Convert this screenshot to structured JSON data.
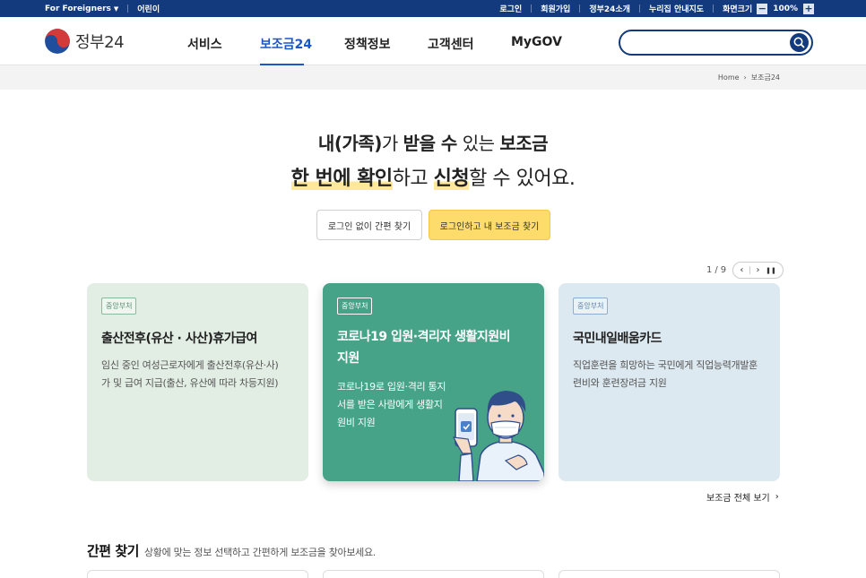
{
  "topbar": {
    "foreigners": "For Foreigners",
    "kids": "어린이",
    "links": [
      "로그인",
      "회원가입",
      "정부24소개",
      "누리집 안내지도"
    ],
    "zoom_label": "화면크기",
    "zoom_minus": "−",
    "zoom_value": "100%",
    "zoom_plus": "+"
  },
  "header": {
    "logo_text": "정부24",
    "nav": [
      "서비스",
      "보조금24",
      "정책정보",
      "고객센터",
      "MyGOV"
    ],
    "active_nav": "보조금24",
    "search_placeholder": ""
  },
  "breadcrumb": [
    "Home",
    "보조금24"
  ],
  "hero": {
    "line1": [
      {
        "text": "내(가족)",
        "style": "bold"
      },
      {
        "text": "가 ",
        "style": "normal"
      },
      {
        "text": "받을 수",
        "style": "bold"
      },
      {
        "text": " 있는 ",
        "style": "normal"
      },
      {
        "text": "보조금",
        "style": "bold"
      }
    ],
    "line2": [
      {
        "text": "한 번에 확인",
        "style": "highlight"
      },
      {
        "text": "하고 ",
        "style": "normal"
      },
      {
        "text": "신청",
        "style": "highlight"
      },
      {
        "text": "할 수 있어요.",
        "style": "normal"
      }
    ]
  },
  "buttons": {
    "guest": "로그인 없이 간편 찾기",
    "login": "로그인하고 내 보조금 찾기"
  },
  "pager": {
    "current": "1",
    "sep": "/",
    "total": "9",
    "prev": "‹",
    "next": "›",
    "pause": "❚❚"
  },
  "cards": [
    {
      "tag": "중앙부처",
      "title": "출산전후(유산 · 사산)휴가급여",
      "desc": [
        "임신 중인 여성근로자에게 출산전후(유산·사)",
        "가 및 급여 지급(출산, 유산에 따라 차등지원)"
      ]
    },
    {
      "tag": "중앙부처",
      "title": [
        "코로나19 입원·격리자 생활지원비",
        "지원"
      ],
      "desc": [
        "코로나19로 입원·격리 통지",
        "서를 받은 사람에게 생활지",
        "원비 지원"
      ]
    },
    {
      "tag": "중앙부처",
      "title": "국민내일배움카드",
      "desc": [
        "직업훈련을 희망하는 국민에게 직업능력개발훈",
        "련비와 훈련장려금 지원"
      ]
    }
  ],
  "view_all": "보조금 전체 보기",
  "quick_find": {
    "title": "간편 찾기",
    "desc": "상황에 맞는 정보 선택하고 간편하게 보조금을 찾아보세요."
  },
  "colors": {
    "navy": "#123a7c",
    "accent_blue": "#1d57c6",
    "yellow": "#fddc6b",
    "green_card": "#46a388"
  }
}
